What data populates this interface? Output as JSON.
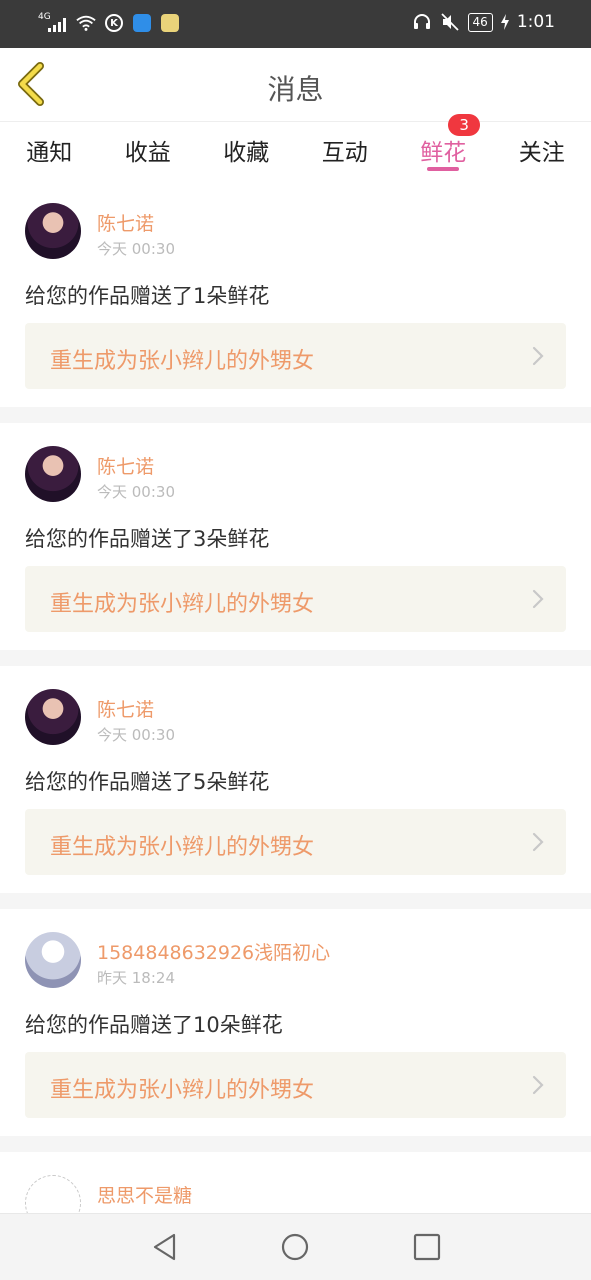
{
  "status_bar": {
    "network_label": "4G",
    "battery": "46",
    "time": "1:01",
    "icons": [
      "signal-icon",
      "wifi-icon",
      "k-app-icon",
      "blue-app-icon",
      "yellow-app-icon",
      "headset-icon",
      "mute-icon",
      "battery-icon",
      "charging-icon"
    ]
  },
  "header": {
    "title": "消息",
    "back_icon": "back-chevron-icon"
  },
  "tabs": [
    {
      "label": "通知",
      "active": false
    },
    {
      "label": "收益",
      "active": false
    },
    {
      "label": "收藏",
      "active": false
    },
    {
      "label": "互动",
      "active": false
    },
    {
      "label": "鲜花",
      "active": true,
      "badge": "3"
    },
    {
      "label": "关注",
      "active": false
    }
  ],
  "colors": {
    "accent": "#e060a0",
    "username": "#ee9a6a",
    "badge": "#f0373f",
    "work_bg": "#f6f5ee"
  },
  "messages": [
    {
      "username": "陈七诺",
      "time": "今天 00:30",
      "text": "给您的作品赠送了1朵鲜花",
      "work_title": "重生成为张小辫儿的外甥女"
    },
    {
      "username": "陈七诺",
      "time": "今天 00:30",
      "text": "给您的作品赠送了3朵鲜花",
      "work_title": "重生成为张小辫儿的外甥女"
    },
    {
      "username": "陈七诺",
      "time": "今天 00:30",
      "text": "给您的作品赠送了5朵鲜花",
      "work_title": "重生成为张小辫儿的外甥女"
    },
    {
      "username": "1584848632926浅陌初心",
      "time": "昨天 18:24",
      "text": "给您的作品赠送了10朵鲜花",
      "work_title": "重生成为张小辫儿的外甥女"
    },
    {
      "username": "思思不是糖"
    }
  ],
  "nav_bar": {
    "icons": [
      "back-triangle-icon",
      "home-circle-icon",
      "recents-square-icon"
    ]
  }
}
